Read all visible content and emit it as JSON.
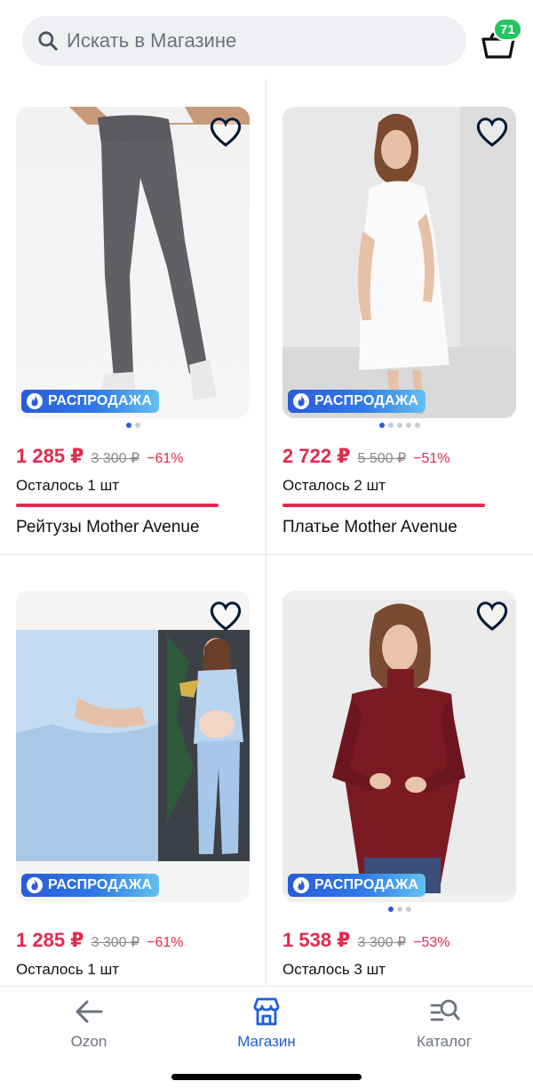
{
  "search": {
    "placeholder": "Искать в Магазине"
  },
  "cart": {
    "count": "71"
  },
  "products": [
    {
      "price": "1 285 ₽",
      "old_price": "3 300 ₽",
      "discount": "−61%",
      "stock": "Осталось 1 шт",
      "title": "Рейтузы Mother Avenue",
      "badge": "РАСПРОДАЖА",
      "dots": 2,
      "active_dot": 0
    },
    {
      "price": "2 722 ₽",
      "old_price": "5 500 ₽",
      "discount": "−51%",
      "stock": "Осталось 2 шт",
      "title": "Платье Mother Avenue",
      "badge": "РАСПРОДАЖА",
      "dots": 5,
      "active_dot": 0
    },
    {
      "price": "1 285 ₽",
      "old_price": "3 300 ₽",
      "discount": "−61%",
      "stock": "Осталось 1 шт",
      "title": "",
      "badge": "РАСПРОДАЖА",
      "dots": 0,
      "active_dot": 0
    },
    {
      "price": "1 538 ₽",
      "old_price": "3 300 ₽",
      "discount": "−53%",
      "stock": "Осталось 3 шт",
      "title": "",
      "badge": "РАСПРОДАЖА",
      "dots": 3,
      "active_dot": 0
    }
  ],
  "nav": [
    {
      "label": "Ozon",
      "icon": "back-arrow-icon"
    },
    {
      "label": "Магазин",
      "icon": "store-icon"
    },
    {
      "label": "Каталог",
      "icon": "catalog-search-icon"
    }
  ],
  "colors": {
    "price": "#e5294d",
    "accent": "#1e5fd8",
    "badge": "#22c55e"
  }
}
